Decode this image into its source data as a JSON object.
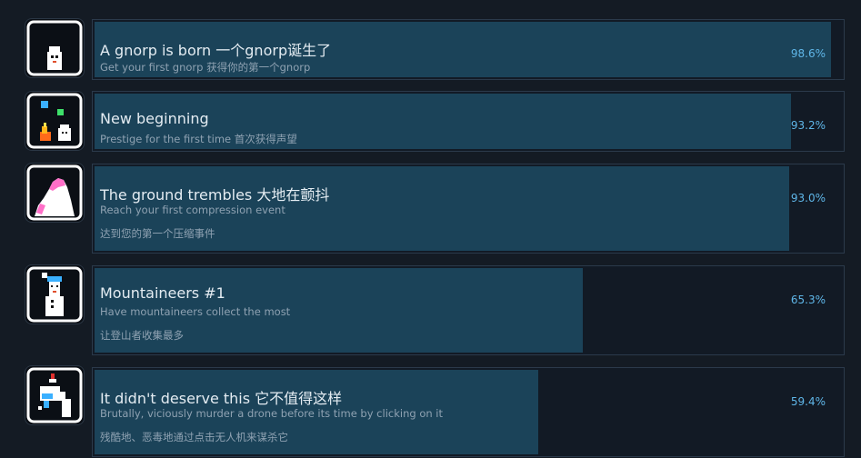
{
  "achievements": [
    {
      "title": "A gnorp is born 一个gnorp诞生了",
      "description": "Get your first gnorp 获得你的第一个gnorp",
      "description_2": "",
      "percent_text": "98.6%",
      "percent": 98.6,
      "icon": "gnorp-icon"
    },
    {
      "title": "New beginning",
      "description": "Prestige for the first time 首次获得声望",
      "description_2": "",
      "percent_text": "93.2%",
      "percent": 93.2,
      "icon": "fire-gnorp-icon"
    },
    {
      "title": "The ground trembles 大地在颤抖",
      "description": "Reach your first compression event",
      "description_2": "达到您的第一个压缩事件",
      "percent_text": "93.0%",
      "percent": 93.0,
      "icon": "pink-mountain-icon"
    },
    {
      "title": "Mountaineers #1",
      "description": "Have mountaineers collect the most",
      "description_2": "让登山者收集最多",
      "percent_text": "65.3%",
      "percent": 65.3,
      "icon": "mountaineer-icon"
    },
    {
      "title": "It didn't deserve this 它不值得这样",
      "description": "Brutally, viciously murder a drone before its time by clicking on it",
      "description_2": "残酷地、恶毒地通过点击无人机来谋杀它",
      "percent_text": "59.4%",
      "percent": 59.4,
      "icon": "drone-hand-icon"
    }
  ],
  "colors": {
    "background": "#141b24",
    "bar_fill": "#1b4359",
    "percent_text": "#5fb6e8"
  }
}
